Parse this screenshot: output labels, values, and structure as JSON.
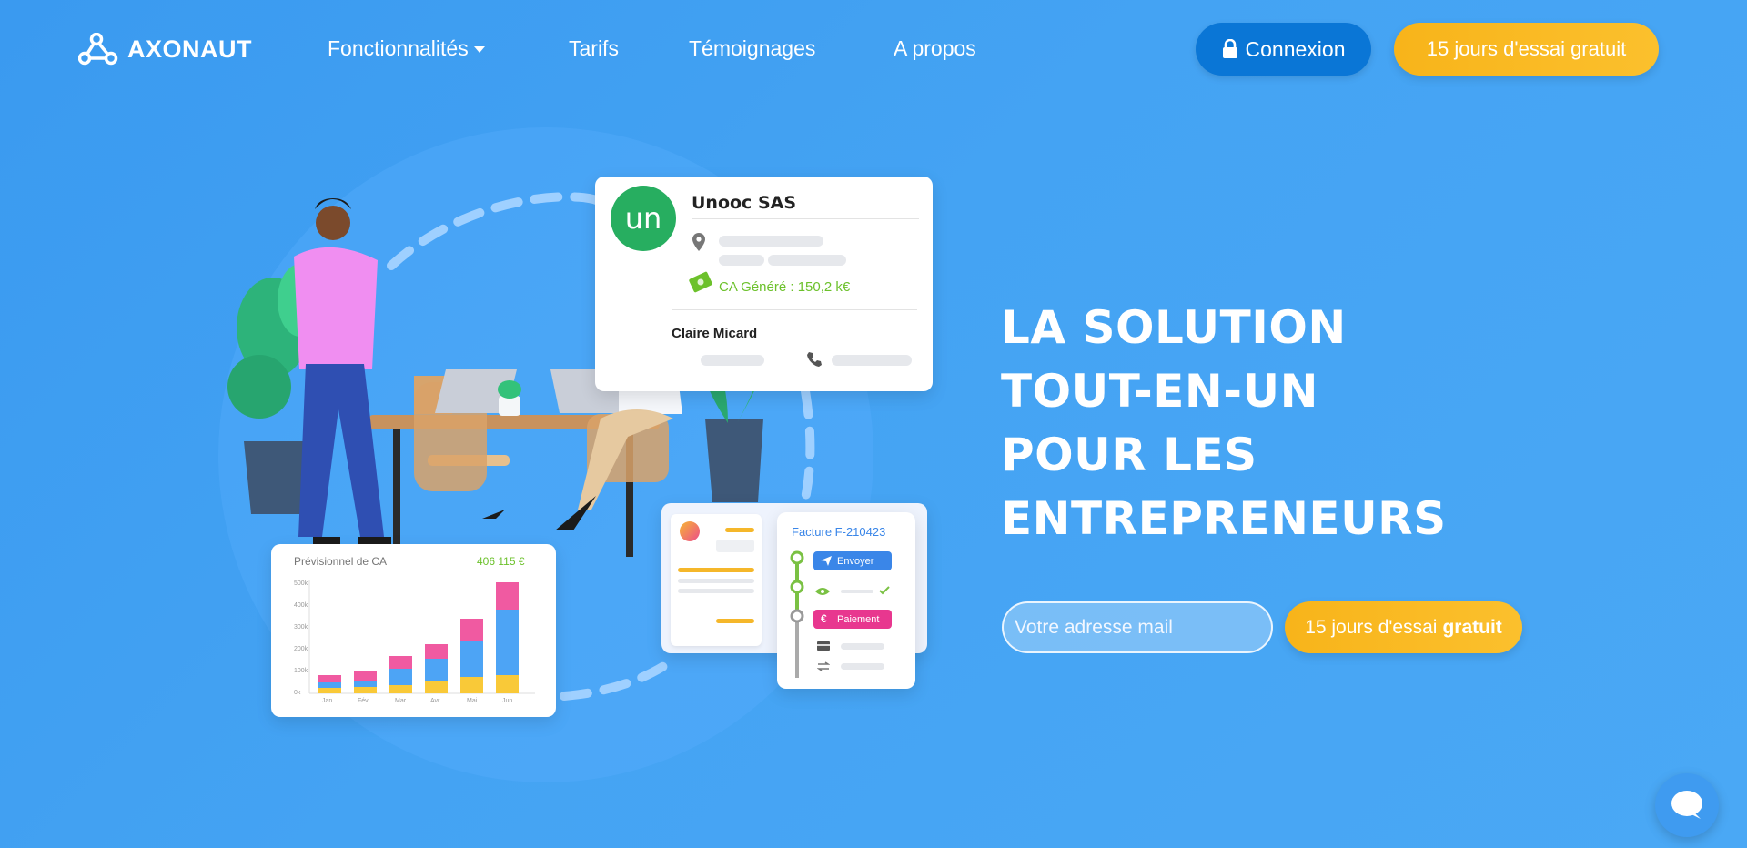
{
  "brand": {
    "name": "AXONAUT"
  },
  "nav": {
    "items": [
      {
        "label": "Fonctionnalités",
        "has_dropdown": true
      },
      {
        "label": "Tarifs"
      },
      {
        "label": "Témoignages"
      },
      {
        "label": "A propos"
      }
    ],
    "login_label": "Connexion",
    "trial_label": "15 jours d'essai gratuit"
  },
  "hero": {
    "title_lines": [
      "LA SOLUTION",
      "TOUT-EN-UN",
      "POUR LES",
      "ENTREPRENEURS"
    ],
    "email_placeholder": "Votre adresse mail",
    "cta_prefix": "15 jours d'essai",
    "cta_bold": "gratuit"
  },
  "illustration": {
    "company_card": {
      "logo_text": "un",
      "name": "Unooc SAS",
      "revenue": "CA Généré : 150,2 k€",
      "contact": "Claire Micard"
    },
    "forecast_card": {
      "title": "Prévisionnel de CA",
      "total": "406 115 €",
      "y_ticks": [
        "500k",
        "400k",
        "300k",
        "200k",
        "100k",
        "0k"
      ],
      "months": [
        "Jan",
        "Fév",
        "Mar",
        "Avr",
        "Mai",
        "Jun"
      ]
    },
    "invoice_card": {
      "title": "Facture F-210423",
      "send_label": "Envoyer",
      "payment_label": "Paiement"
    }
  },
  "colors": {
    "background": "#44a3f3",
    "login_button": "#0a76d6",
    "cta": "#f9b81f",
    "accent_green": "#6cc12b",
    "send_blue": "#3a86e8",
    "payment_pink": "#e8378f"
  }
}
